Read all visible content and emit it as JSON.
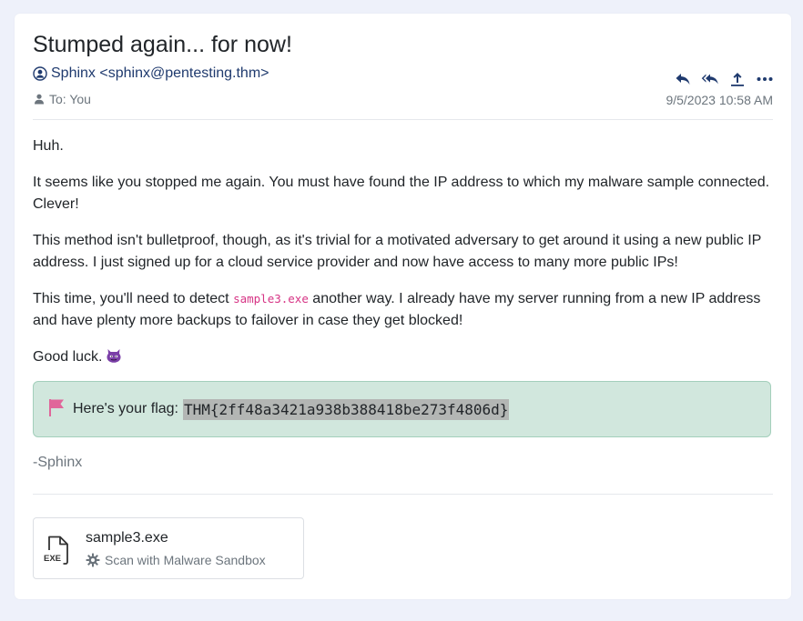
{
  "email": {
    "subject": "Stumped again... for now!",
    "from": "Sphinx <sphinx@pentesting.thm>",
    "to": "To: You",
    "date": "9/5/2023 10:58 AM",
    "actions": [
      {
        "name": "reply",
        "icon": "reply-icon"
      },
      {
        "name": "reply-all",
        "icon": "reply-all-icon"
      },
      {
        "name": "forward",
        "icon": "share-icon"
      },
      {
        "name": "more",
        "icon": "more-icon"
      }
    ]
  },
  "body": {
    "p1": "Huh.",
    "p2": "It seems like you stopped me again. You must have found the IP address to which my malware sample connected. Clever!",
    "p3": "This method isn't bulletproof, though, as it's trivial for a motivated adversary to get around it using a new public IP address. I just signed up for a cloud service provider and now have access to many more public IPs!",
    "p4_before": "This time, you'll need to detect ",
    "p4_code": "sample3.exe",
    "p4_after": " another way. I already have my server running from a new IP address and have plenty more backups to failover in case they get blocked!",
    "p5": "Good luck.",
    "p5_emoji": "imp-emoji"
  },
  "flag": {
    "label": "Here's your flag:",
    "value": "THM{2ff48a3421a938b388418be273f4806d}",
    "icon": "flag-icon"
  },
  "signature": "-Sphinx",
  "attachment": {
    "filename": "sample3.exe",
    "icon_label": "EXE",
    "scan_label": "Scan with Malware Sandbox"
  },
  "colors": {
    "accent": "#1f3a6e",
    "flag_bg": "#d1e7dd",
    "flag_border": "#a3cfbb",
    "code": "#d63384",
    "background": "#eef1fa"
  }
}
